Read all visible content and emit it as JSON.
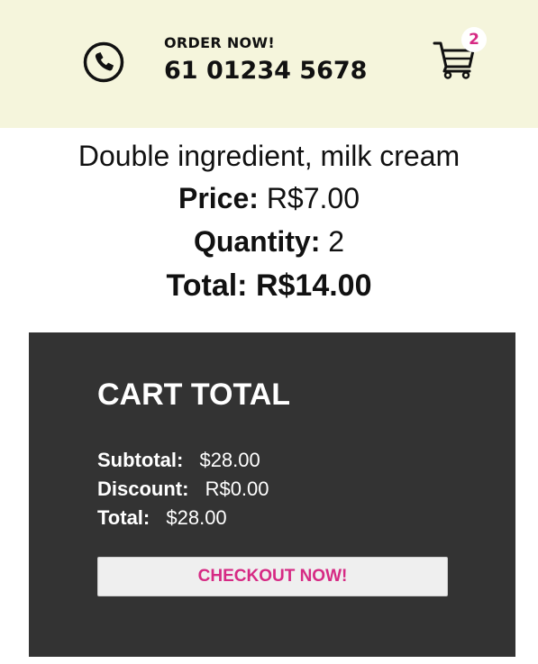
{
  "header": {
    "order_label": "ORDER NOW!",
    "phone_number": "61 01234 5678",
    "phone_icon": "phone-icon",
    "cart_icon": "shopping-cart-icon",
    "cart_count": "2",
    "badge_color": "#d62a84",
    "background": "#f5f5dc"
  },
  "product": {
    "name": "Double ingredient, milk cream",
    "price_label": "Price:",
    "price_value": "R$7.00",
    "quantity_label": "Quantity:",
    "quantity_value": "2",
    "total_label": "Total:",
    "total_value": "R$14.00"
  },
  "cart_total": {
    "title": "CART TOTAL",
    "subtotal_label": "Subtotal:",
    "subtotal_value": "$28.00",
    "discount_label": "Discount:",
    "discount_value": "R$0.00",
    "total_label": "Total:",
    "total_value": "$28.00",
    "checkout_label": "CHECKOUT NOW!",
    "panel_color": "#333333",
    "accent_color": "#d62a84"
  }
}
